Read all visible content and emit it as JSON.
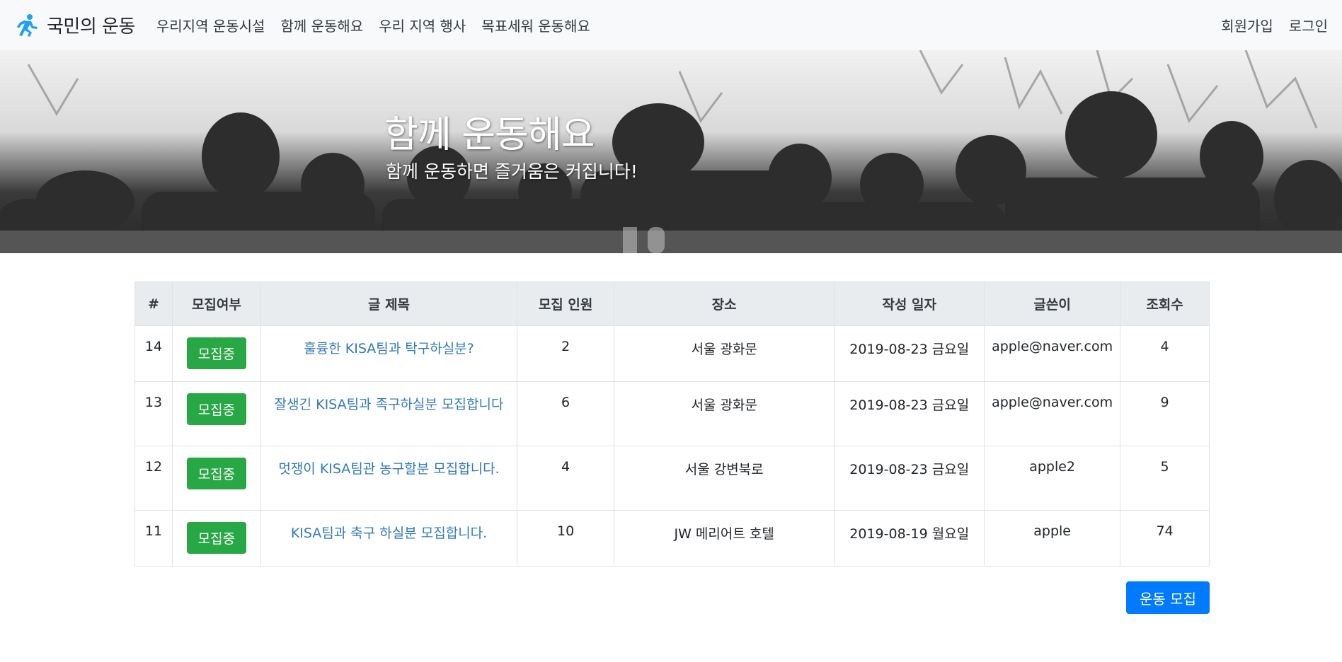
{
  "navbar": {
    "brand": "국민의 운동",
    "links": [
      "우리지역 운동시설",
      "함께 운동해요",
      "우리 지역 행사",
      "목표세워 운동해요"
    ],
    "right_links": [
      "회원가입",
      "로그인"
    ],
    "brand_icon": "runner-icon",
    "brand_color": "#1da1f2"
  },
  "hero": {
    "title": "함께 운동해요",
    "subtitle": "함께 운동하면 즐거움은 커집니다!"
  },
  "table": {
    "headers": [
      "#",
      "모집여부",
      "글 제목",
      "모집 인원",
      "장소",
      "작성 일자",
      "글쓴이",
      "조회수"
    ],
    "rows": [
      {
        "no": "14",
        "status": "모집중",
        "title": "훌륭한 KISA팀과 탁구하실분?",
        "members": "2",
        "place": "서울 광화문",
        "date": "2019-08-23 금요일",
        "author": "apple@naver.com",
        "views": "4"
      },
      {
        "no": "13",
        "status": "모집중",
        "title": "잘생긴 KISA팀과 족구하실분 모집합니다",
        "members": "6",
        "place": "서울 광화문",
        "date": "2019-08-23 금요일",
        "author": "apple@naver.com",
        "views": "9"
      },
      {
        "no": "12",
        "status": "모집중",
        "title": "멋쟁이 KISA팀관 농구할분 모집합니다.",
        "members": "4",
        "place": "서울 강변북로",
        "date": "2019-08-23 금요일",
        "author": "apple2",
        "views": "5"
      },
      {
        "no": "11",
        "status": "모집중",
        "title": "KISA팀과 축구 하실분 모집합니다.",
        "members": "10",
        "place": "JW 메리어트 호텔",
        "date": "2019-08-19 월요일",
        "author": "apple",
        "views": "74"
      }
    ]
  },
  "recruit_button": "운동 모집",
  "colors": {
    "status_green": "#28a745",
    "primary_blue": "#007bff",
    "link_blue": "#337ab7"
  }
}
